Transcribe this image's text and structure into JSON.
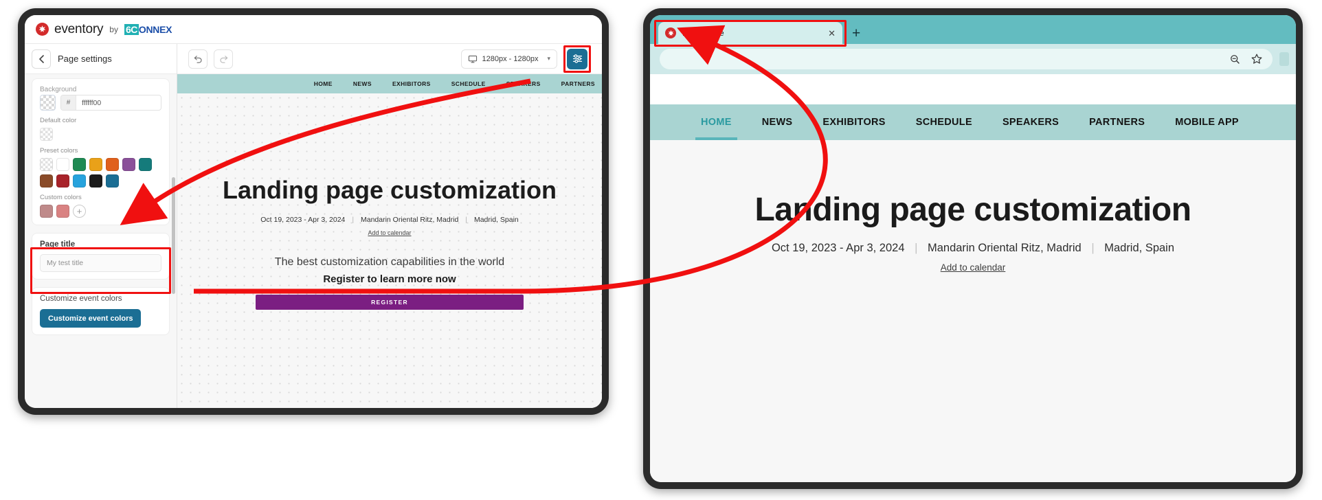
{
  "editor": {
    "brand": {
      "name": "eventory",
      "by": "by",
      "partner_a": "6C",
      "partner_b": "ONNEX"
    },
    "sidebar": {
      "back_label": "‹",
      "title": "Page settings",
      "background_label": "Background",
      "hex_prefix": "#",
      "hex_value": "ffffff00",
      "default_color_label": "Default color",
      "preset_colors_label": "Preset colors",
      "preset_colors": [
        "transparent",
        "#ffffff",
        "#1f8a53",
        "#e9a119",
        "#e0601c",
        "#8a5099",
        "#157b7b",
        "#8a4b29",
        "#a8232a",
        "#27a3dd",
        "#1c1c1c",
        "#1b6e94"
      ],
      "custom_colors_label": "Custom colors",
      "custom_colors": [
        "#bf8a8a",
        "#d98282"
      ],
      "add_color_label": "+",
      "page_title_label": "Page title",
      "page_title_value": "My test title",
      "customize_label": "Customize event colors",
      "customize_button": "Customize event colors"
    },
    "toolbar": {
      "undo_icon": "undo-icon",
      "redo_icon": "redo-icon",
      "viewport_label": "1280px - 1280px",
      "viewport_caret": "⌄",
      "settings_icon": "sliders-icon"
    },
    "preview": {
      "nav": [
        "HOME",
        "NEWS",
        "EXHIBITORS",
        "SCHEDULE",
        "SPEAKERS",
        "PARTNERS"
      ],
      "title": "Landing page customization",
      "dates": "Oct 19, 2023 - Apr 3, 2024",
      "venue": "Mandarin Oriental Ritz, Madrid",
      "city": "Madrid, Spain",
      "add_to_calendar": "Add to calendar",
      "subtitle": "The best customization capabilities in the world",
      "subtitle_bold": "Register to learn more now",
      "cta": "REGISTER"
    }
  },
  "browser": {
    "tab": {
      "title": "My test title",
      "close": "✕",
      "favicon": "eventory-favicon"
    },
    "new_tab": "+",
    "omnibox": {
      "value": "",
      "zoom_icon": "zoom-out-icon",
      "bookmark_icon": "star-icon"
    },
    "site": {
      "nav": [
        "HOME",
        "NEWS",
        "EXHIBITORS",
        "SCHEDULE",
        "SPEAKERS",
        "PARTNERS",
        "MOBILE APP"
      ],
      "active_nav": "HOME",
      "title": "Landing page customization",
      "dates": "Oct 19, 2023 - Apr 3, 2024",
      "venue": "Mandarin Oriental Ritz, Madrid",
      "city": "Madrid, Spain",
      "add_to_calendar": "Add to calendar"
    }
  },
  "annotations": {
    "highlight_color": "#f01010",
    "arrow_color": "#f01010",
    "boxes": [
      "page-title-field",
      "settings-button",
      "browser-tab"
    ],
    "arrows": [
      "settings-to-colors",
      "page-title-to-tab"
    ]
  }
}
